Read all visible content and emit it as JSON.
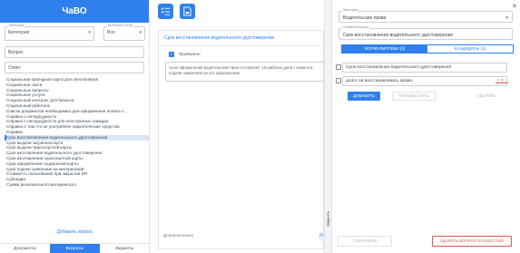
{
  "left": {
    "title": "ЧаВО",
    "category": {
      "caption": "Категория",
      "value": "Категория"
    },
    "status": {
      "caption": "Выберите статус",
      "value": "Все"
    },
    "question_field": "Вопрос",
    "answer_field": "Ответ",
    "questions": [
      "Социальная проездная карта для пенсионеров",
      "Социальное такси",
      "Социальные вопросы",
      "Социальные услуги",
      "Социальный контракт для бизнеса",
      "Социальный работник",
      "Список документов необходимых для оформления полиса о...",
      "Справка о неподсудности",
      "Справка о неподсудности для иностранных граждан",
      "Справка о том что не употреблял наркотические средства",
      "Справки",
      "Срок восстановления водительского удостоверения",
      "Срок выдачи загранпаспорта",
      "Срок выдачи транспортной карты",
      "Срок изготовления водительского удостоверения",
      "Срок изготовления транспортной карты",
      "Срок оформления социальной карты",
      "Срок подачи заявления на материнский",
      "Стоимость пользования при закрытии ИП",
      "Субсидии",
      "Сумма регионального материнского"
    ],
    "active_question_index": 11,
    "add_question": "Добавить вопрос",
    "tabs": [
      "Документы",
      "Вопросы",
      "Виджеты"
    ],
    "active_tab": 1
  },
  "middle": {
    "title": "Срок восстановления водительского удостоверения",
    "checkbox_label": "Проверено",
    "answer_text": "Срок оформления водительских прав составляет 15 рабочих дней с момента подачи заявления на его оформление",
    "note": "Дополнительно",
    "side_button": "ДОБА"
  },
  "divider": {
    "close_label": "Закрыть"
  },
  "right": {
    "category": {
      "caption": "Категория",
      "value": "Водительские права"
    },
    "question": {
      "caption": "Основной вопрос",
      "value": "Срок восстановления водительского удостоверения"
    },
    "tabs": [
      "ФОРМУЛИРОВКИ (2)",
      "КАНДИДАТЫ (1)"
    ],
    "active_tab": 0,
    "wordings": [
      "Срок восстановления водительского удостоверения",
      "долго ли восстанавливать права"
    ],
    "buttons": {
      "add": "ДОБАВИТЬ",
      "move": "ПЕРЕМЕСТИТЬ",
      "delete": "УДАЛИТЬ"
    },
    "bottom": {
      "save": "СОХРАНИТЬ",
      "delete_all": "УДАЛИТЬ ВОПРОС ПОЛНОСТЬЮ"
    }
  },
  "colors": {
    "accent": "#2f80ed",
    "danger": "#e25555"
  }
}
